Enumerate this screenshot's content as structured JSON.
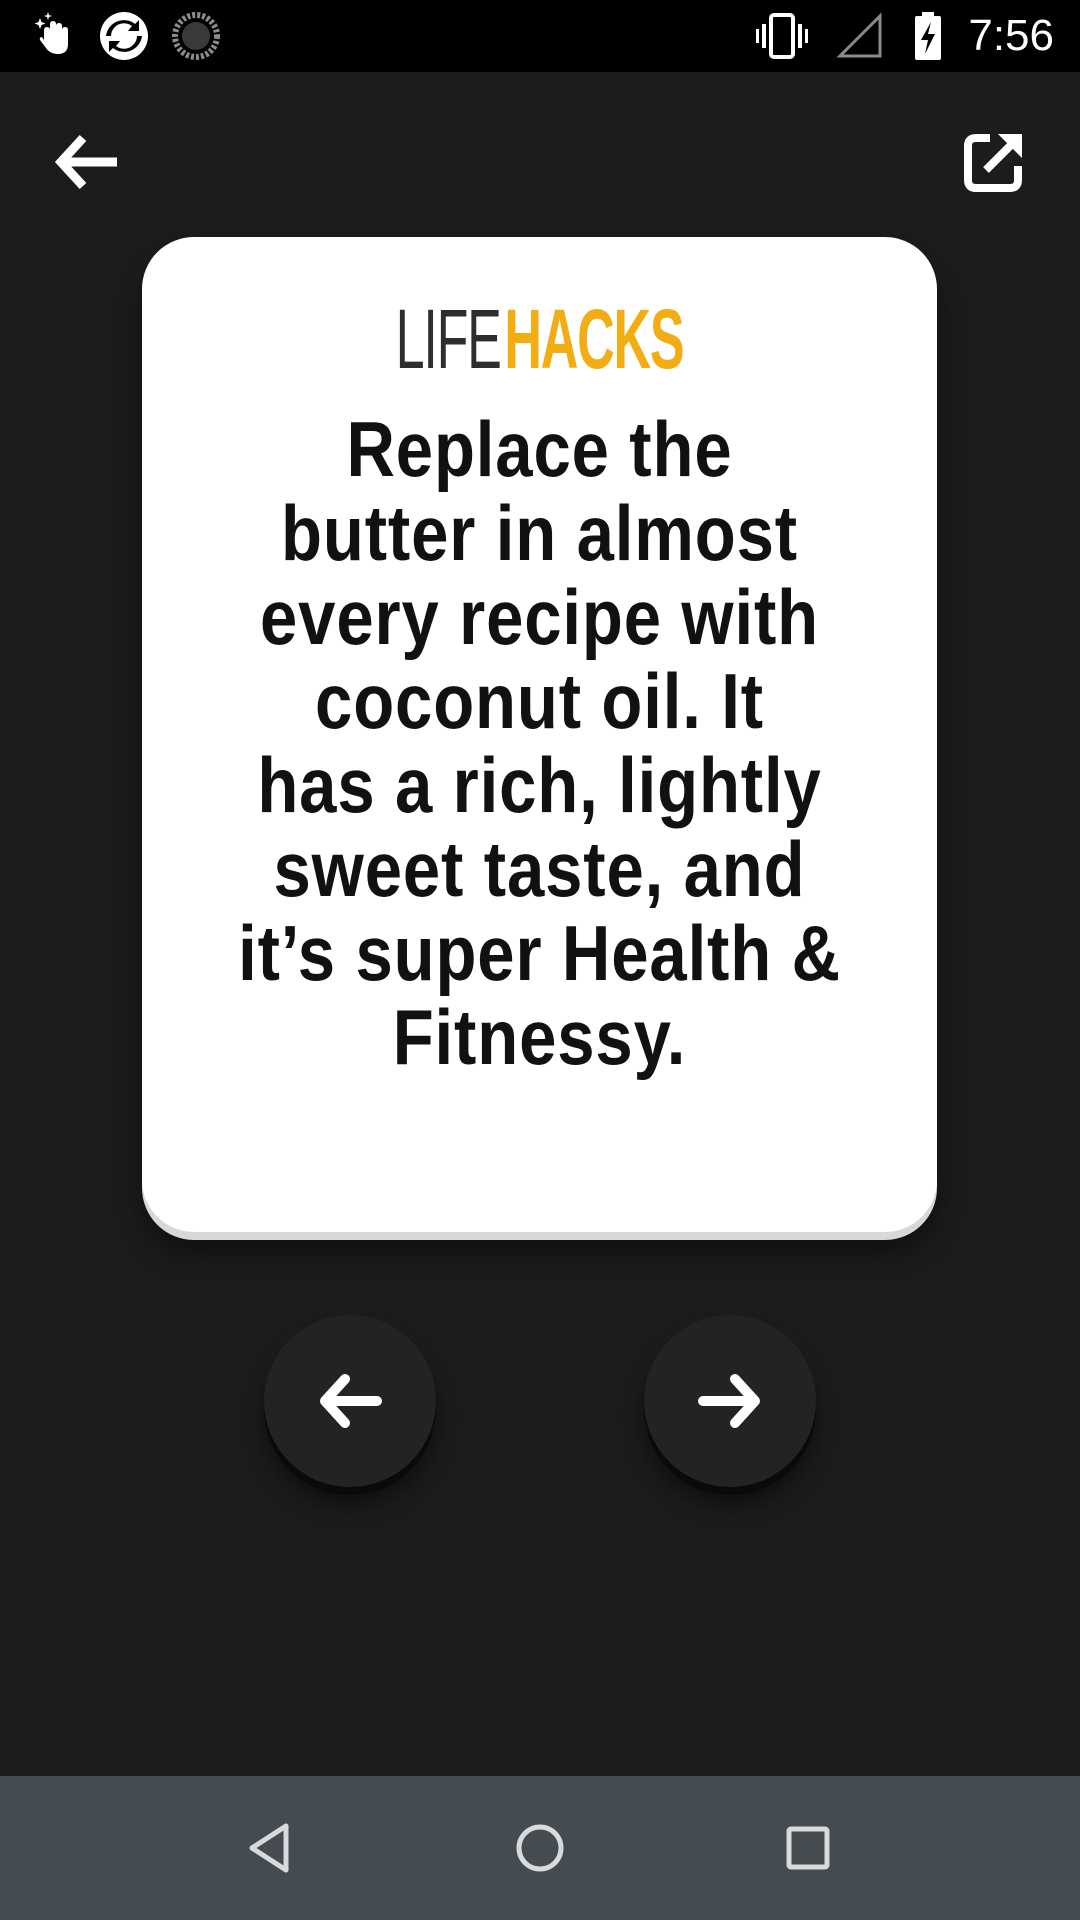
{
  "status_bar": {
    "time": "7:56",
    "icons": [
      "hand-sparkle-icon",
      "sync-logo-icon",
      "loading-spinner-icon",
      "vibrate-icon",
      "no-signal-icon",
      "battery-charging-icon"
    ]
  },
  "app_bar": {
    "back_icon": "back-arrow-icon",
    "share_icon": "share-external-icon"
  },
  "card": {
    "brand_word1": "LIFE",
    "brand_word2": "HACKS",
    "hack_lines": [
      "Replace the",
      "butter in almost",
      "every recipe with",
      "coconut oil. It",
      "has a rich, lightly",
      "sweet taste, and",
      "it’s super Health &",
      "Fitnessy."
    ]
  },
  "navigation": {
    "prev_icon": "arrow-left-icon",
    "next_icon": "arrow-right-icon"
  },
  "system_nav": {
    "buttons": [
      "back-triangle-icon",
      "home-circle-icon",
      "recents-square-icon"
    ]
  },
  "colors": {
    "background": "#1c1c1e",
    "card": "#ffffff",
    "accent": "#f2ac14",
    "status_bar": "#000000",
    "system_nav": "#444b51"
  }
}
